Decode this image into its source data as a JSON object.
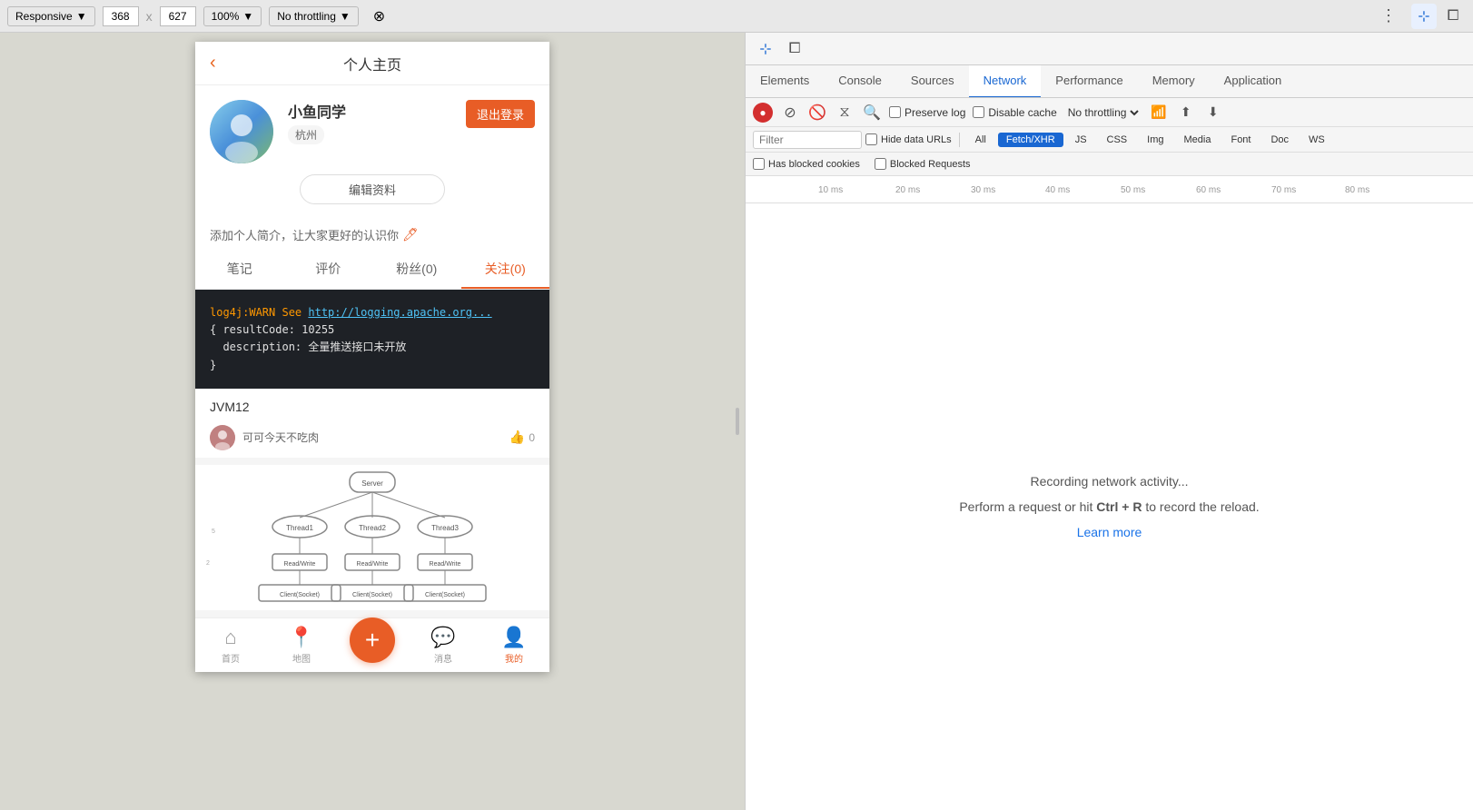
{
  "toolbar": {
    "responsive_label": "Responsive",
    "width": "368",
    "x_label": "x",
    "height": "627",
    "zoom": "100%",
    "throttle": "No throttling",
    "more_label": "⋮"
  },
  "devtools": {
    "tabs": [
      {
        "id": "elements",
        "label": "Elements",
        "active": false
      },
      {
        "id": "console",
        "label": "Console",
        "active": false
      },
      {
        "id": "sources",
        "label": "Sources",
        "active": false
      },
      {
        "id": "network",
        "label": "Network",
        "active": true
      },
      {
        "id": "performance",
        "label": "Performance",
        "active": false
      },
      {
        "id": "memory",
        "label": "Memory",
        "active": false
      },
      {
        "id": "application",
        "label": "Application",
        "active": false
      }
    ],
    "network": {
      "preserve_log_label": "Preserve log",
      "disable_cache_label": "Disable cache",
      "throttle_label": "No throttling",
      "filter_placeholder": "Filter",
      "hide_data_urls_label": "Hide data URLs",
      "all_label": "All",
      "fetch_xhr_label": "Fetch/XHR",
      "js_label": "JS",
      "css_label": "CSS",
      "img_label": "Img",
      "media_label": "Media",
      "font_label": "Font",
      "doc_label": "Doc",
      "ws_label": "WS",
      "has_blocked_cookies_label": "Has blocked cookies",
      "blocked_requests_label": "Blocked Requests",
      "timeline_labels": [
        "10 ms",
        "20 ms",
        "30 ms",
        "40 ms",
        "50 ms",
        "60 ms",
        "70 ms",
        "80 ms"
      ],
      "empty_title": "Recording network activity...",
      "empty_subtitle_prefix": "Perform a request or hit ",
      "empty_shortcut": "Ctrl + R",
      "empty_subtitle_suffix": " to record the reload.",
      "learn_more_label": "Learn more"
    }
  },
  "mobile": {
    "page_title": "个人主页",
    "profile": {
      "name": "小鱼同学",
      "location": "杭州",
      "logout_btn": "退出登录",
      "edit_btn": "编辑资料",
      "bio": "添加个人简介，让大家更好的认识你",
      "bio_edit_icon": "🖊"
    },
    "tabs": [
      {
        "label": "笔记",
        "active": false
      },
      {
        "label": "评价",
        "active": false
      },
      {
        "label": "粉丝(0)",
        "active": false
      },
      {
        "label": "关注(0)",
        "active": true
      }
    ],
    "cards": [
      {
        "type": "code",
        "code_lines": [
          {
            "type": "warn",
            "prefix": "log4j:WARN See ",
            "link": "http://logging.apache.org..."
          },
          {
            "type": "normal",
            "text": "{ resultCode: 10255"
          },
          {
            "type": "normal",
            "text": "  description: 全量推送接口未开放"
          },
          {
            "type": "normal",
            "text": "}"
          }
        ],
        "title": "JVM12",
        "author_name": "可可今天不吃肉",
        "likes": "0"
      }
    ],
    "bottom_nav": [
      {
        "label": "首页",
        "icon": "⌂",
        "active": false
      },
      {
        "label": "地图",
        "icon": "📍",
        "active": false
      },
      {
        "label": "",
        "icon": "+",
        "is_center": true
      },
      {
        "label": "消息",
        "icon": "💬",
        "active": false
      },
      {
        "label": "我的",
        "icon": "👤",
        "active": true
      }
    ]
  }
}
